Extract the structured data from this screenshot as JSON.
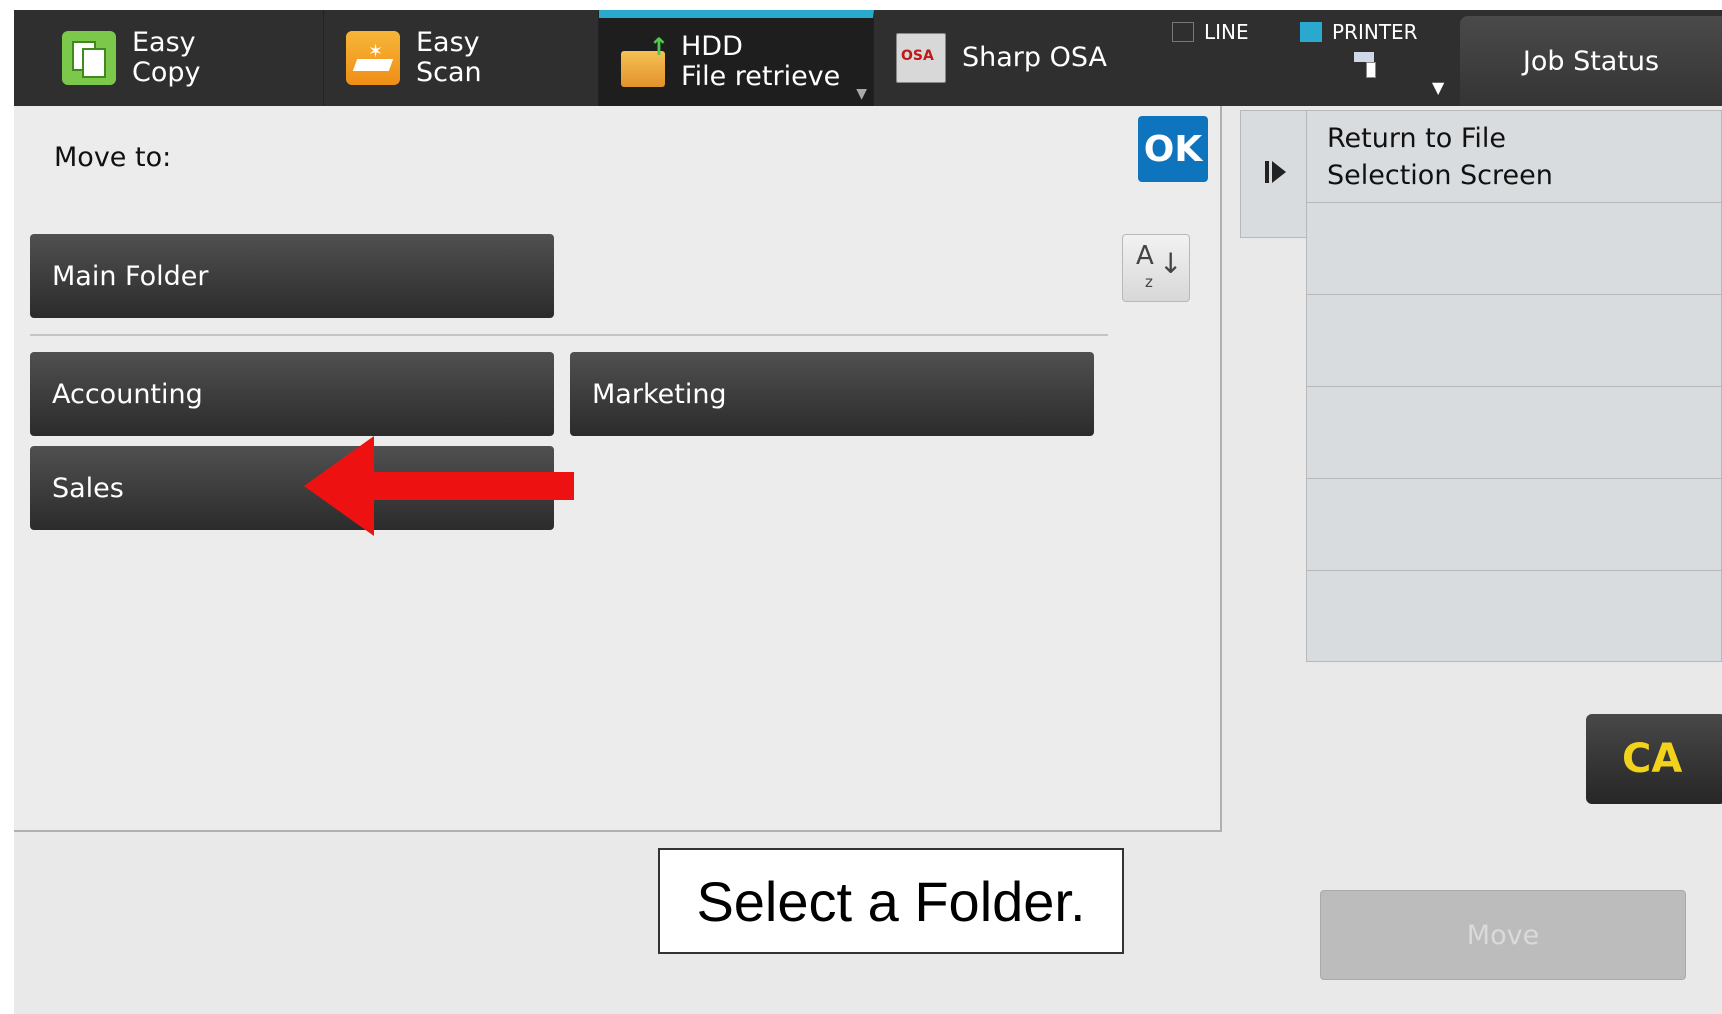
{
  "topbar": {
    "tabs": [
      {
        "label": "Easy\nCopy",
        "icon": "copy-icon",
        "active": false
      },
      {
        "label": "Easy\nScan",
        "icon": "scan-icon",
        "active": false
      },
      {
        "label": "HDD\nFile retrieve",
        "icon": "folder-upload-icon",
        "active": true
      },
      {
        "label": "Sharp OSA",
        "icon": "osa-icon",
        "active": false
      }
    ],
    "indicators": {
      "line": "LINE",
      "printer": "PRINTER"
    },
    "job_status": "Job Status"
  },
  "main": {
    "move_to_label": "Move to:",
    "ok": "OK",
    "sort_icon": "sort-az-icon",
    "main_folder": "Main Folder",
    "folders": [
      "Accounting",
      "Marketing",
      "Sales"
    ]
  },
  "side": {
    "tasks": [
      "Return to File\nSelection Screen",
      "",
      "",
      "",
      "",
      ""
    ],
    "ca": "CA",
    "move": "Move"
  },
  "caption": "Select a Folder.",
  "colors": {
    "accent": "#2aa9cf",
    "ok_blue": "#0f74be",
    "ca_yellow": "#f3d21c",
    "arrow_red": "#ee1111"
  }
}
